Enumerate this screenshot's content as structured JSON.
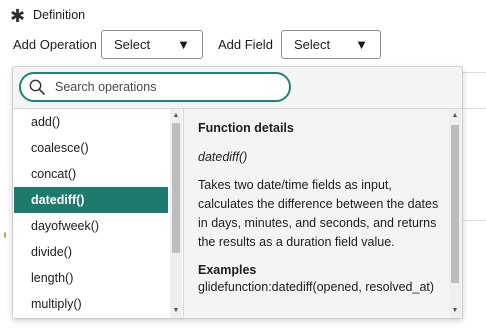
{
  "definition": {
    "title": "Definition",
    "icon": "asterisk-icon"
  },
  "operation": {
    "label": "Add Operation",
    "select_value": "Select"
  },
  "field": {
    "label": "Add Field",
    "select_value": "Select"
  },
  "search": {
    "placeholder": "Search operations",
    "value": ""
  },
  "operations": [
    {
      "label": "add()",
      "selected": false
    },
    {
      "label": "coalesce()",
      "selected": false
    },
    {
      "label": "concat()",
      "selected": false
    },
    {
      "label": "datediff()",
      "selected": true
    },
    {
      "label": "dayofweek()",
      "selected": false
    },
    {
      "label": "divide()",
      "selected": false
    },
    {
      "label": "length()",
      "selected": false
    },
    {
      "label": "multiply()",
      "selected": false
    }
  ],
  "details": {
    "heading": "Function details",
    "function_name": "datediff()",
    "description": "Takes two date/time fields as input, calculates the difference between the dates in days, minutes, and seconds, and returns the results as a duration field value.",
    "examples_label": "Examples",
    "example_code": "glidefunction:datediff(opened, resolved_at)"
  },
  "colors": {
    "accent": "#1f7a6e",
    "search_border": "#1f8476",
    "pane_bg": "#f4f4f4"
  }
}
